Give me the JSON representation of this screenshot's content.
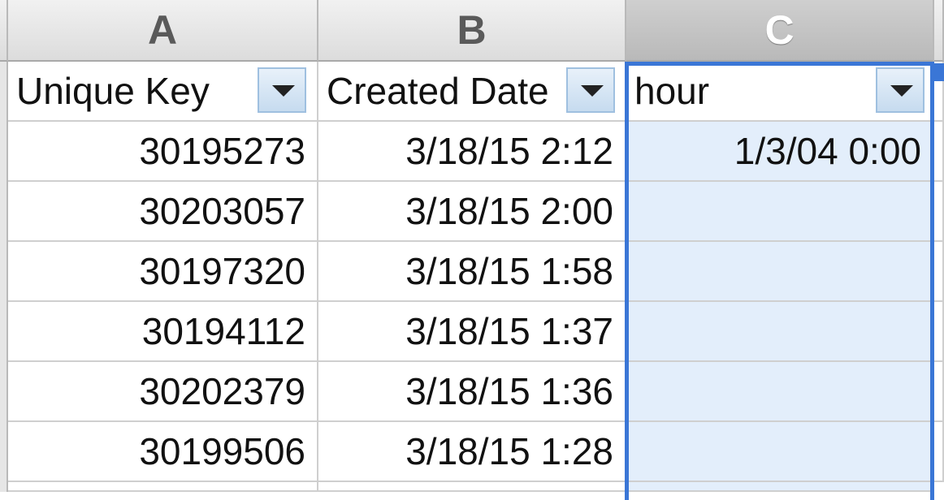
{
  "columns": [
    "A",
    "B",
    "C"
  ],
  "header_row": [
    "Unique Key",
    "Created Date",
    "hour"
  ],
  "rows": [
    [
      "30195273",
      "3/18/15 2:12",
      "1/3/04 0:00"
    ],
    [
      "30203057",
      "3/18/15 2:00",
      ""
    ],
    [
      "30197320",
      "3/18/15 1:58",
      ""
    ],
    [
      "30194112",
      "3/18/15 1:37",
      ""
    ],
    [
      "30202379",
      "3/18/15 1:36",
      ""
    ],
    [
      "30199506",
      "3/18/15 1:28",
      ""
    ]
  ],
  "selected_column": "C",
  "colors": {
    "selection_border": "#3a76d6",
    "selection_fill": "#e3eefb"
  }
}
